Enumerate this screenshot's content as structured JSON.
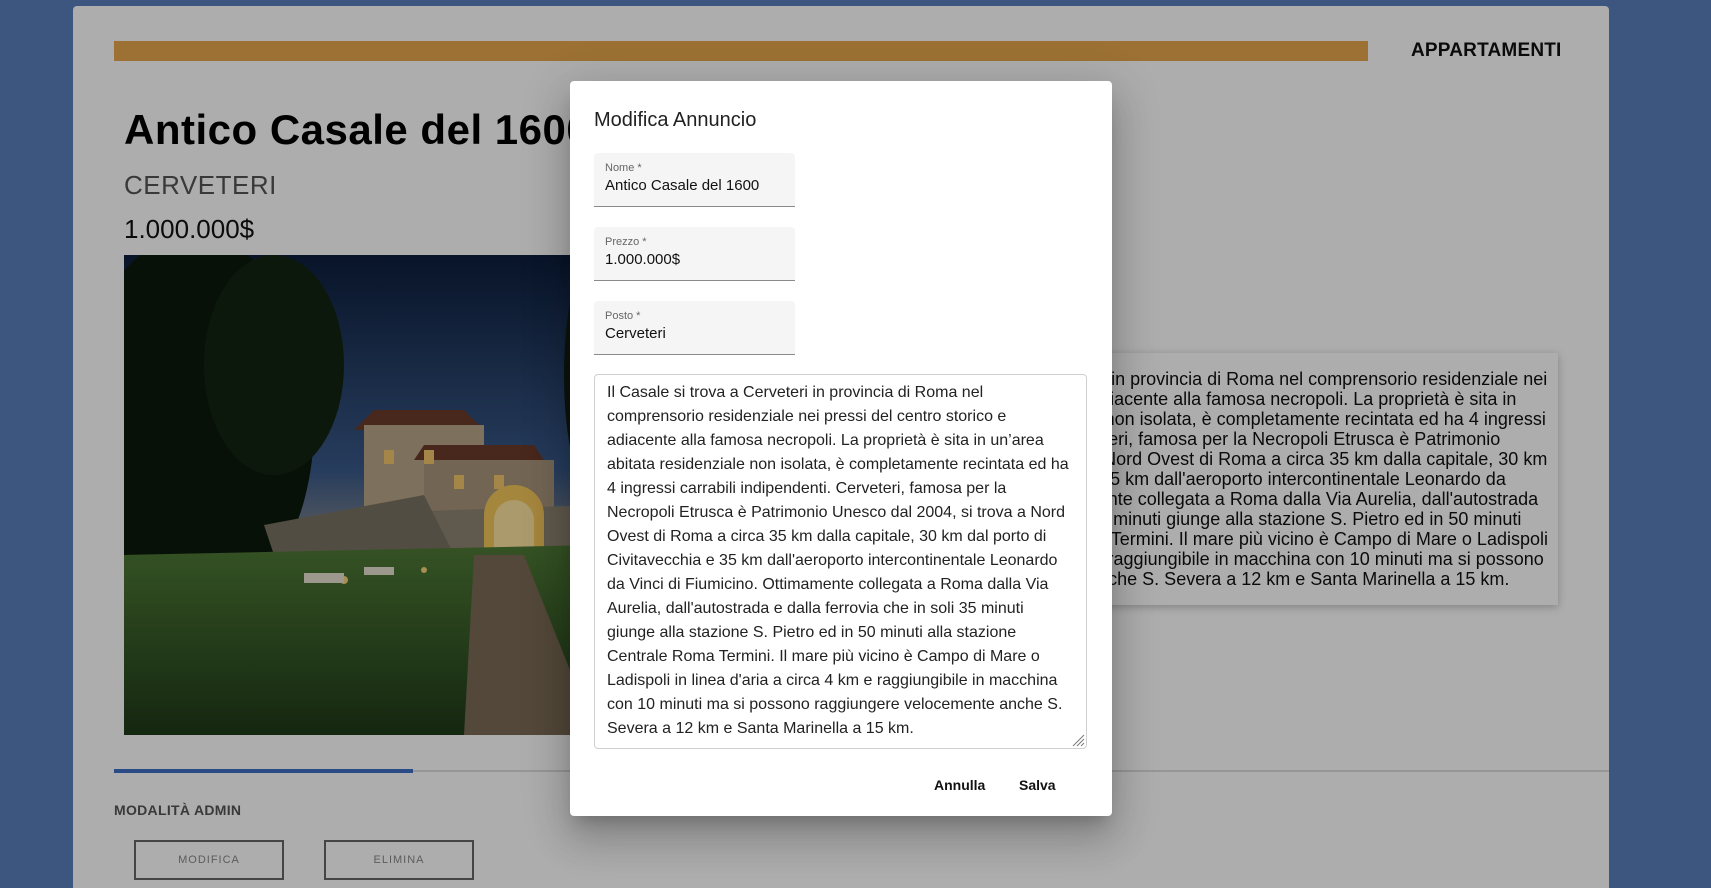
{
  "colors": {
    "background": "#5a7fbd",
    "accent_bar": "#e6a74c",
    "tab_active": "#3f6fc4"
  },
  "nav": {
    "title": "APPARTAMENTI"
  },
  "property": {
    "title": "Antico Casale del 1600",
    "location": "CERVETERI",
    "price": "1.000.000$",
    "description_visible": "Il Casale si trova a Cerveteri in provincia di Roma nel comprensorio residenziale nei pressi del centro storico e adiacente alla famosa necropoli. La proprietà è sita in un'area abitata residenziale non isolata, è completamente recintata ed ha 4 ingressi carrabili indipendenti. Cerveteri, famosa per la Necropoli Etrusca è Patrimonio Unesco dal 2004, si trova a Nord Ovest di Roma a circa 35 km dalla capitale, 30 km dal porto di Civitavecchia e 35 km dall'aeroporto intercontinentale Leonardo da Vinci di Fiumicino. Ottimamente collegata a Roma dalla Via Aurelia, dall'autostrada e dalla ferrovia che in soli 35 minuti giunge alla stazione S. Pietro ed in 50 minuti alla stazione Centrale Roma Termini. Il mare più vicino è Campo di Mare o Ladispoli in linea d'aria a circa 4 km e raggiungibile in macchina con 10 minuti ma si possono raggiungere velocemente anche S. Severa a 12 km e Santa Marinella a 15 km."
  },
  "admin": {
    "label": "MODALITÀ ADMIN",
    "edit_label": "MODIFICA",
    "delete_label": "ELIMINA"
  },
  "dialog": {
    "title": "Modifica Annuncio",
    "fields": {
      "nome": {
        "label": "Nome *",
        "value": "Antico Casale del 1600"
      },
      "prezzo": {
        "label": "Prezzo *",
        "value": "1.000.000$"
      },
      "posto": {
        "label": "Posto *",
        "value": "Cerveteri"
      }
    },
    "description": "Il Casale si trova a Cerveteri in provincia di Roma nel comprensorio residenziale nei pressi del centro storico e adiacente alla famosa necropoli. La proprietà è sita in un’area abitata residenziale non isolata, è completamente recintata ed ha 4 ingressi carrabili indipendenti. Cerveteri, famosa per la Necropoli Etrusca è Patrimonio Unesco dal 2004, si trova a Nord Ovest di Roma a circa 35 km dalla capitale, 30 km dal porto di Civitavecchia e 35 km dall'aeroporto intercontinentale Leonardo da Vinci di Fiumicino. Ottimamente collegata a Roma dalla Via Aurelia, dall'autostrada e dalla ferrovia che in soli 35 minuti giunge alla stazione S. Pietro ed in 50 minuti alla stazione Centrale Roma Termini. Il mare più vicino è Campo di Mare o Ladispoli in linea d'aria a circa 4 km e raggiungibile in macchina con 10 minuti ma si possono raggiungere velocemente anche S. Severa a 12 km e Santa Marinella a 15 km.",
    "cancel_label": "Annulla",
    "save_label": "Salva"
  }
}
